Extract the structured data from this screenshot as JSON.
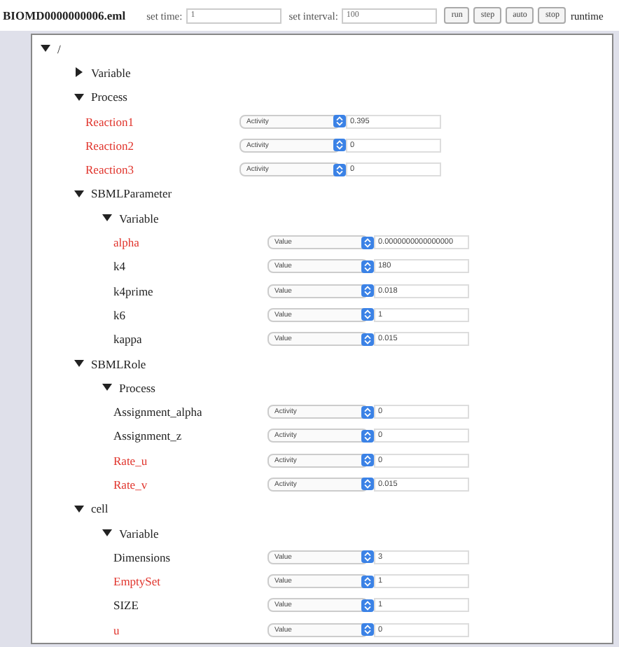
{
  "toolbar": {
    "file": "BIOMD0000000006.eml",
    "time_label": "set time:",
    "time_value": "1",
    "interval_label": "set interval:",
    "interval_value": "100",
    "buttons": [
      "run",
      "step",
      "auto",
      "stop"
    ],
    "runtime_label": "runtime"
  },
  "tree": {
    "label": "/",
    "expanded": true,
    "children": [
      {
        "label": "Variable",
        "expanded": false
      },
      {
        "label": "Process",
        "expanded": true,
        "children": [
          {
            "kind": "leaf",
            "label": "Reaction1",
            "color": "#e0332b",
            "property": "Activity",
            "value": "0.395"
          },
          {
            "kind": "leaf",
            "label": "Reaction2",
            "color": "#e0332b",
            "property": "Activity",
            "value": "0"
          },
          {
            "kind": "leaf",
            "label": "Reaction3",
            "color": "#e0332b",
            "property": "Activity",
            "value": "0"
          }
        ]
      },
      {
        "label": "SBMLParameter",
        "expanded": true,
        "children": [
          {
            "label": "Variable",
            "expanded": true,
            "children": [
              {
                "kind": "leaf",
                "label": "alpha",
                "color": "#e0332b",
                "property": "Value",
                "value": "0.0000000000000000"
              },
              {
                "kind": "leaf",
                "label": "k4",
                "color": "#222222",
                "property": "Value",
                "value": "180"
              },
              {
                "kind": "leaf",
                "label": "k4prime",
                "color": "#222222",
                "property": "Value",
                "value": "0.018"
              },
              {
                "kind": "leaf",
                "label": "k6",
                "color": "#222222",
                "property": "Value",
                "value": "1"
              },
              {
                "kind": "leaf",
                "label": "kappa",
                "color": "#222222",
                "property": "Value",
                "value": "0.015"
              }
            ]
          }
        ]
      },
      {
        "label": "SBMLRole",
        "expanded": true,
        "children": [
          {
            "label": "Process",
            "expanded": true,
            "children": [
              {
                "kind": "leaf",
                "label": "Assignment_alpha",
                "color": "#222222",
                "property": "Activity",
                "value": "0"
              },
              {
                "kind": "leaf",
                "label": "Assignment_z",
                "color": "#222222",
                "property": "Activity",
                "value": "0"
              },
              {
                "kind": "leaf",
                "label": "Rate_u",
                "color": "#e0332b",
                "property": "Activity",
                "value": "0"
              },
              {
                "kind": "leaf",
                "label": "Rate_v",
                "color": "#e0332b",
                "property": "Activity",
                "value": "0.015"
              }
            ]
          }
        ]
      },
      {
        "label": "cell",
        "expanded": true,
        "children": [
          {
            "label": "Variable",
            "expanded": true,
            "children": [
              {
                "kind": "leaf",
                "label": "Dimensions",
                "color": "#222222",
                "property": "Value",
                "value": "3"
              },
              {
                "kind": "leaf",
                "label": "EmptySet",
                "color": "#e0332b",
                "property": "Value",
                "value": "1"
              },
              {
                "kind": "leaf",
                "label": "SIZE",
                "color": "#222222",
                "property": "Value",
                "value": "1"
              },
              {
                "kind": "leaf",
                "label": "u",
                "color": "#e0332b",
                "property": "Value",
                "value": "0"
              }
            ]
          }
        ]
      }
    ]
  }
}
